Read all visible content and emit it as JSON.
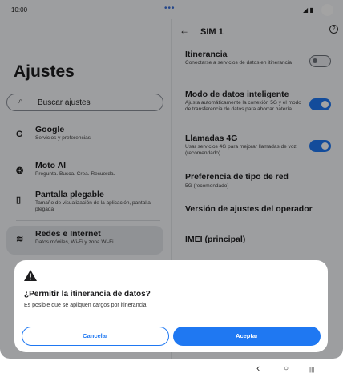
{
  "status_bar": {
    "time": "10:00",
    "signal": "◢ ▮",
    "dots": "•••"
  },
  "left_pane": {
    "title": "Ajustes",
    "search_placeholder": "Buscar ajustes",
    "items": [
      {
        "icon": "google-icon",
        "glyph": "G",
        "title": "Google",
        "subtitle": "Servicios y preferencias"
      },
      {
        "icon": "moto-ai-icon",
        "glyph": "❂",
        "title": "Moto AI",
        "subtitle": "Pregunta. Busca. Crea. Recuerda."
      },
      {
        "icon": "foldable-screen-icon",
        "glyph": "▯",
        "title": "Pantalla plegable",
        "subtitle": "Tamaño de visualización de la aplicación, pantalla plegada"
      },
      {
        "icon": "wifi-icon",
        "glyph": "≋",
        "title": "Redes e Internet",
        "subtitle": "Datos móviles, Wi-Fi y zona Wi-Fi"
      }
    ]
  },
  "right_pane": {
    "title": "SIM 1",
    "help_glyph": "?",
    "rows": [
      {
        "title": "Itinerancia",
        "subtitle": "Conectarse a servicios de datos en itinerancia",
        "toggle": "off"
      },
      {
        "title": "Modo de datos inteligente",
        "subtitle": "Ajusta automáticamente la conexión 5G y el modo de transferencia de datos para ahorrar batería",
        "toggle": "on"
      },
      {
        "title": "Llamadas 4G",
        "subtitle": "Usar servicios 4G para mejorar llamadas de voz (recomendado)",
        "toggle": "on"
      },
      {
        "title": "Preferencia de tipo de red",
        "subtitle": "5G (recomendado)"
      },
      {
        "title": "Versión de ajustes del operador",
        "subtitle": ""
      },
      {
        "title": "IMEI (principal)",
        "subtitle": ""
      }
    ]
  },
  "dialog": {
    "title": "¿Permitir la itinerancia de datos?",
    "message": "Es posible que se apliquen cargos por itinerancia.",
    "cancel_label": "Cancelar",
    "accept_label": "Aceptar"
  },
  "nav_bar": {
    "back": "‹",
    "home": "○",
    "recents": "|||"
  },
  "colors": {
    "accent": "#1f78f2",
    "background": "#f6f7fb"
  }
}
